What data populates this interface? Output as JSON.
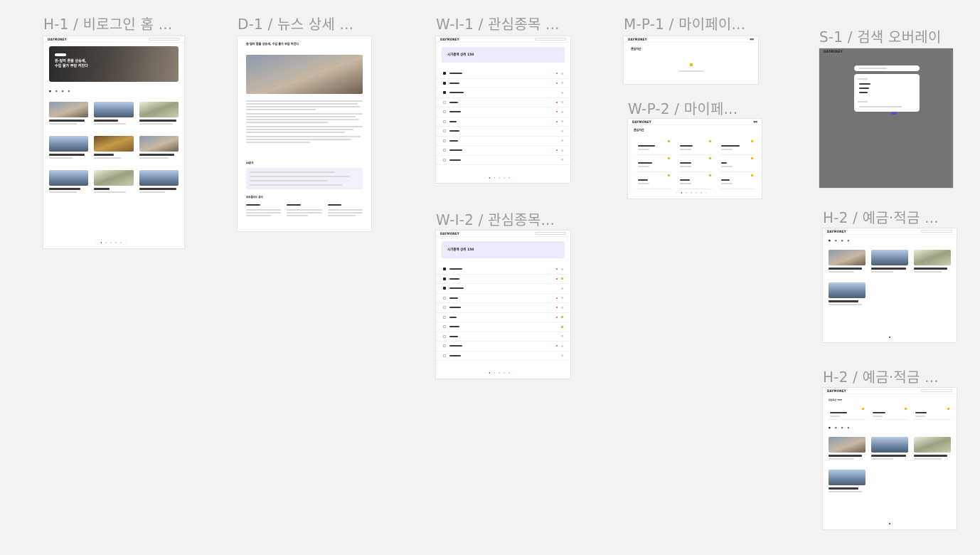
{
  "frames": {
    "h1": {
      "title": "H-1 / 비로그인 홈 ..."
    },
    "d1": {
      "title": "D-1 / 뉴스 상세 ..."
    },
    "wi1": {
      "title": "W-I-1 / 관심종목 ..."
    },
    "mp1": {
      "title": "M-P-1 / 마이페이..."
    },
    "s1": {
      "title": "S-1 / 검색 오버레이"
    },
    "wp2": {
      "title": "W-P-2 / 마이페..."
    },
    "h2a": {
      "title": "H-2 / 예금·적금 ..."
    },
    "wi2": {
      "title": "W-I-2 / 관심종목..."
    },
    "h2b": {
      "title": "H-2 / 예금·적금 ..."
    }
  },
  "app": {
    "logo": "DAYMONEY"
  },
  "mini": {
    "hero_title": "원-달러 환율 상승세,",
    "hero_title2": "수입 물가 부담 커진다",
    "news_title": "원·달러 환율 상승세, 수입 물가 부담 커진다",
    "section_analysis": "AI분석",
    "section_industry": "포트폴리오 분석",
    "wi_banner": "시가총액 상위 150",
    "wi_banner_b": "시가총액 상위 150",
    "mp_title": "관심자산",
    "wp_title": "관심자산",
    "h2b_section": "관심자산 TOP",
    "pages": [
      "‹",
      "1",
      "2",
      "3",
      "4",
      "5",
      "›"
    ]
  }
}
